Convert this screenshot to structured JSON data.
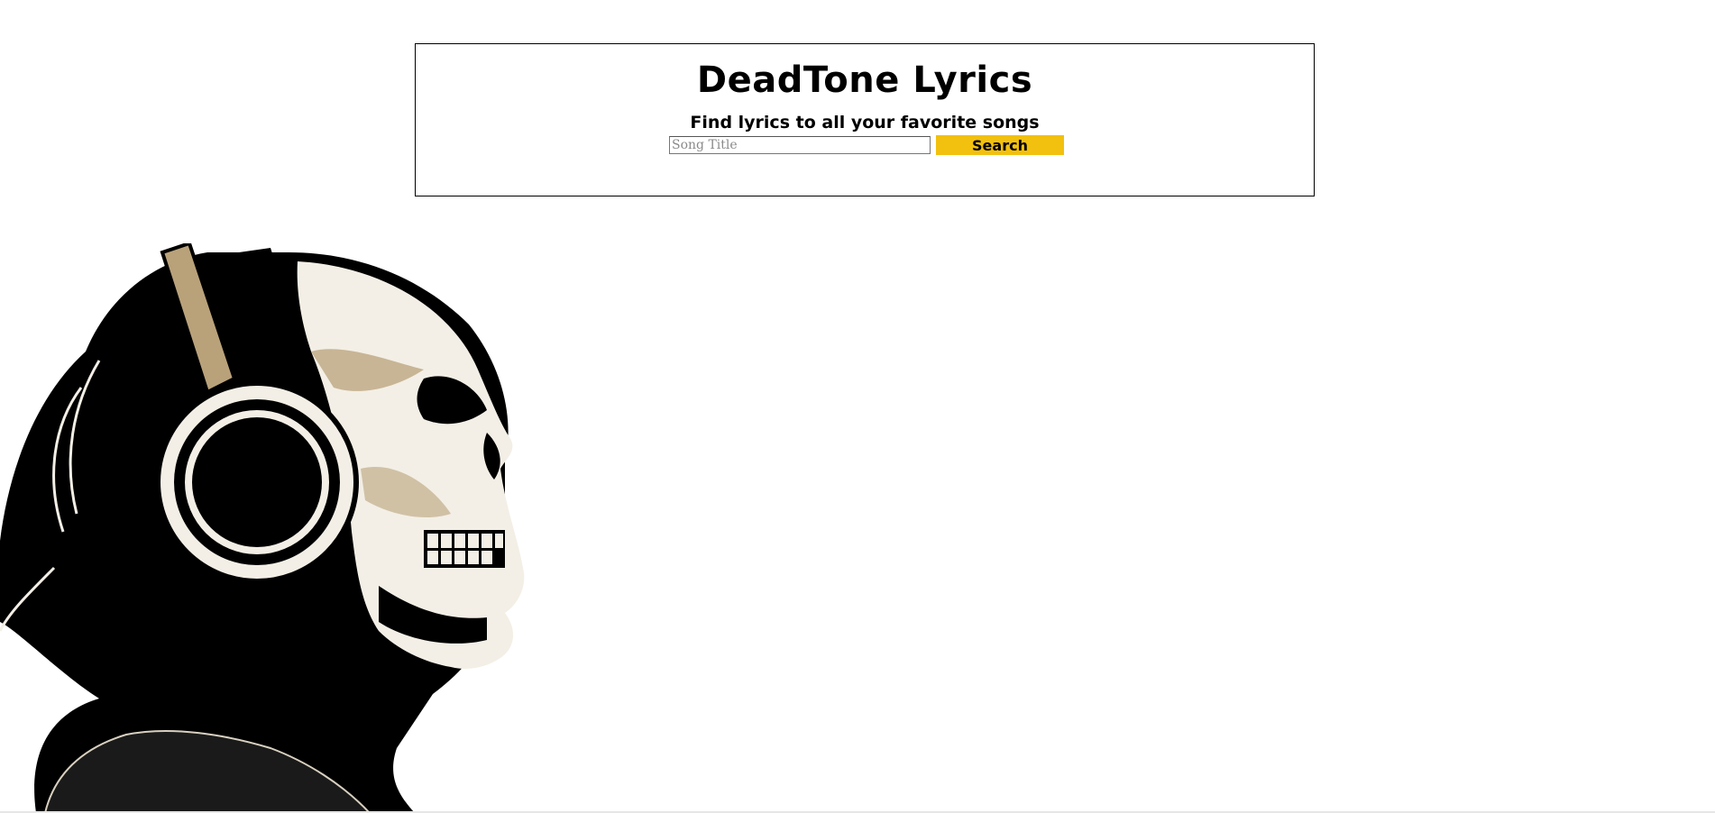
{
  "header": {
    "title": "DeadTone Lyrics",
    "subtitle": "Find lyrics to all your favorite songs"
  },
  "search": {
    "placeholder": "Song Title",
    "value": "",
    "button_label": "Search"
  },
  "colors": {
    "accent": "#f2c00e",
    "text": "#000000",
    "background": "#ffffff",
    "art_tint": "#b9a27a"
  },
  "hero": {
    "icon": "skull-headphones-illustration"
  }
}
